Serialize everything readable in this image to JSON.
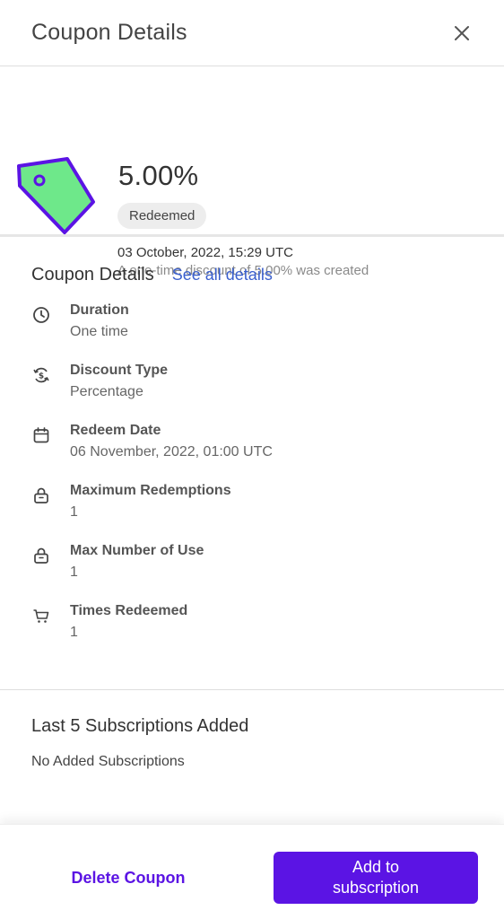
{
  "header": {
    "title": "Coupon Details",
    "close_icon": "close-icon"
  },
  "summary": {
    "icon": "price-tag-icon",
    "amount": "5.00%",
    "status": "Redeemed",
    "created_date": "03 October, 2022, 15:29 UTC",
    "created_description": "A one-time discount of 5.00% was created"
  },
  "details": {
    "title": "Coupon Details",
    "see_all_link": "See all details",
    "items": [
      {
        "icon": "clock-icon",
        "label": "Duration",
        "value": "One time"
      },
      {
        "icon": "discount-cycle-icon",
        "label": "Discount Type",
        "value": "Percentage"
      },
      {
        "icon": "calendar-icon",
        "label": "Redeem Date",
        "value": "06 November, 2022, 01:00 UTC"
      },
      {
        "icon": "lock-icon",
        "label": "Maximum Redemptions",
        "value": "1"
      },
      {
        "icon": "lock-icon",
        "label": "Max Number of Use",
        "value": "1"
      },
      {
        "icon": "cart-icon",
        "label": "Times Redeemed",
        "value": "1"
      }
    ]
  },
  "subscriptions": {
    "title": "Last 5 Subscriptions Added",
    "empty_text": "No Added Subscriptions"
  },
  "footer": {
    "delete_label": "Delete Coupon",
    "add_label": "Add to subscription"
  },
  "colors": {
    "accent": "#5b14e4",
    "link": "#3a5fcd",
    "tag_fill": "#6ee88a",
    "tag_stroke": "#5b14e4",
    "badge_bg": "#ededed"
  }
}
